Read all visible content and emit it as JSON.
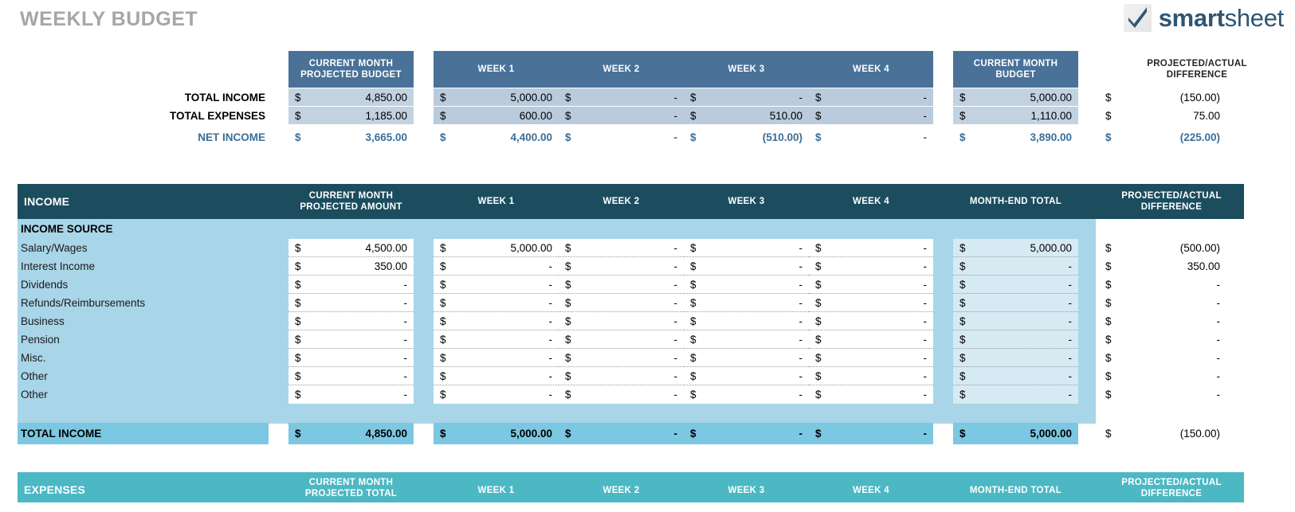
{
  "page_title": "WEEKLY BUDGET",
  "logo": {
    "mark": "checkmark-icon",
    "word_bold": "smart",
    "word_light": "sheet"
  },
  "colors": {
    "title_gray": "#a6a6a6",
    "summary_header_blue": "#4a7299",
    "summary_cell_blue": "#b9cbdd",
    "net_income_blue": "#3b6e96",
    "income_band_teal": "#1c4d5e",
    "income_body_blue": "#a9d5e8",
    "month_end_tint": "#d6eaf4",
    "total_row_blue": "#7cc7e2",
    "expenses_band_teal": "#4cb8c4",
    "logo_blue": "#2e5574"
  },
  "summary": {
    "headers": {
      "projected_budget": "CURRENT MONTH\nPROJECTED BUDGET",
      "projected_budget_l1": "CURRENT MONTH",
      "projected_budget_l2": "PROJECTED BUDGET",
      "week1": "WEEK 1",
      "week2": "WEEK 2",
      "week3": "WEEK 3",
      "week4": "WEEK 4",
      "current_budget_l1": "CURRENT MONTH",
      "current_budget_l2": "BUDGET",
      "difference_l1": "PROJECTED/ACTUAL",
      "difference_l2": "DIFFERENCE"
    },
    "rows": [
      {
        "label": "TOTAL INCOME",
        "projected": "4,850.00",
        "week1": "5,000.00",
        "week2": "-",
        "week3": "-",
        "week4": "-",
        "month_total": "5,000.00",
        "difference": "(150.00)"
      },
      {
        "label": "TOTAL EXPENSES",
        "projected": "1,185.00",
        "week1": "600.00",
        "week2": "-",
        "week3": "510.00",
        "week4": "-",
        "month_total": "1,110.00",
        "difference": "75.00"
      },
      {
        "label": "NET INCOME",
        "projected": "3,665.00",
        "week1": "4,400.00",
        "week2": "-",
        "week3": "(510.00)",
        "week4": "-",
        "month_total": "3,890.00",
        "difference": "(225.00)"
      }
    ],
    "currency": "$"
  },
  "income_section": {
    "title": "INCOME",
    "subheader": "INCOME SOURCE",
    "headers": {
      "projected_l1": "CURRENT MONTH",
      "projected_l2": "PROJECTED AMOUNT",
      "week1": "WEEK 1",
      "week2": "WEEK 2",
      "week3": "WEEK 3",
      "week4": "WEEK 4",
      "month_end": "MONTH-END TOTAL",
      "difference_l1": "PROJECTED/ACTUAL",
      "difference_l2": "DIFFERENCE"
    },
    "rows": [
      {
        "label": "Salary/Wages",
        "projected": "4,500.00",
        "week1": "5,000.00",
        "week2": "-",
        "week3": "-",
        "week4": "-",
        "month_total": "5,000.00",
        "difference": "(500.00)"
      },
      {
        "label": "Interest Income",
        "projected": "350.00",
        "week1": "-",
        "week2": "-",
        "week3": "-",
        "week4": "-",
        "month_total": "-",
        "difference": "350.00"
      },
      {
        "label": "Dividends",
        "projected": "-",
        "week1": "-",
        "week2": "-",
        "week3": "-",
        "week4": "-",
        "month_total": "-",
        "difference": "-"
      },
      {
        "label": "Refunds/Reimbursements",
        "projected": "-",
        "week1": "-",
        "week2": "-",
        "week3": "-",
        "week4": "-",
        "month_total": "-",
        "difference": "-"
      },
      {
        "label": "Business",
        "projected": "-",
        "week1": "-",
        "week2": "-",
        "week3": "-",
        "week4": "-",
        "month_total": "-",
        "difference": "-"
      },
      {
        "label": "Pension",
        "projected": "-",
        "week1": "-",
        "week2": "-",
        "week3": "-",
        "week4": "-",
        "month_total": "-",
        "difference": "-"
      },
      {
        "label": "Misc.",
        "projected": "-",
        "week1": "-",
        "week2": "-",
        "week3": "-",
        "week4": "-",
        "month_total": "-",
        "difference": "-"
      },
      {
        "label": "Other",
        "projected": "-",
        "week1": "-",
        "week2": "-",
        "week3": "-",
        "week4": "-",
        "month_total": "-",
        "difference": "-"
      },
      {
        "label": "Other",
        "projected": "-",
        "week1": "-",
        "week2": "-",
        "week3": "-",
        "week4": "-",
        "month_total": "-",
        "difference": "-"
      }
    ],
    "total": {
      "label": "TOTAL INCOME",
      "projected": "4,850.00",
      "week1": "5,000.00",
      "week2": "-",
      "week3": "-",
      "week4": "-",
      "month_total": "5,000.00",
      "difference": "(150.00)"
    },
    "currency": "$"
  },
  "expenses_section": {
    "title": "EXPENSES",
    "headers": {
      "projected_l1": "CURRENT MONTH",
      "projected_l2": "PROJECTED TOTAL",
      "week1": "WEEK 1",
      "week2": "WEEK 2",
      "week3": "WEEK 3",
      "week4": "WEEK 4",
      "month_end": "MONTH-END TOTAL",
      "difference_l1": "PROJECTED/ACTUAL",
      "difference_l2": "DIFFERENCE"
    }
  }
}
